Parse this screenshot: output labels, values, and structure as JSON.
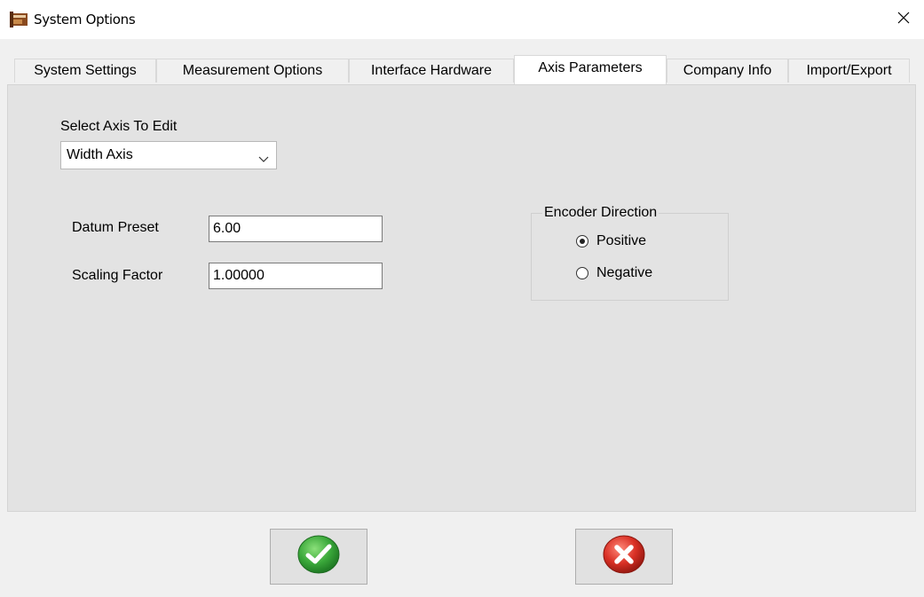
{
  "window": {
    "title": "System Options"
  },
  "tabs": [
    {
      "label": "System Settings",
      "active": false
    },
    {
      "label": "Measurement Options",
      "active": false
    },
    {
      "label": "Interface Hardware",
      "active": false
    },
    {
      "label": "Axis Parameters",
      "active": true
    },
    {
      "label": "Company Info",
      "active": false
    },
    {
      "label": "Import/Export",
      "active": false
    }
  ],
  "axis": {
    "select_label": "Select Axis To Edit",
    "selected": "Width Axis",
    "datum_label": "Datum Preset",
    "datum_value": "6.00",
    "scaling_label": "Scaling Factor",
    "scaling_value": "1.00000"
  },
  "encoder": {
    "title": "Encoder Direction",
    "options": [
      {
        "label": "Positive",
        "selected": true
      },
      {
        "label": "Negative",
        "selected": false
      }
    ]
  },
  "buttons": {
    "ok_icon": "green-checkmark-icon",
    "cancel_icon": "red-x-icon"
  },
  "colors": {
    "ok_green": "#3aa83a",
    "cancel_red": "#d93025",
    "panel_bg": "#e3e3e3"
  }
}
